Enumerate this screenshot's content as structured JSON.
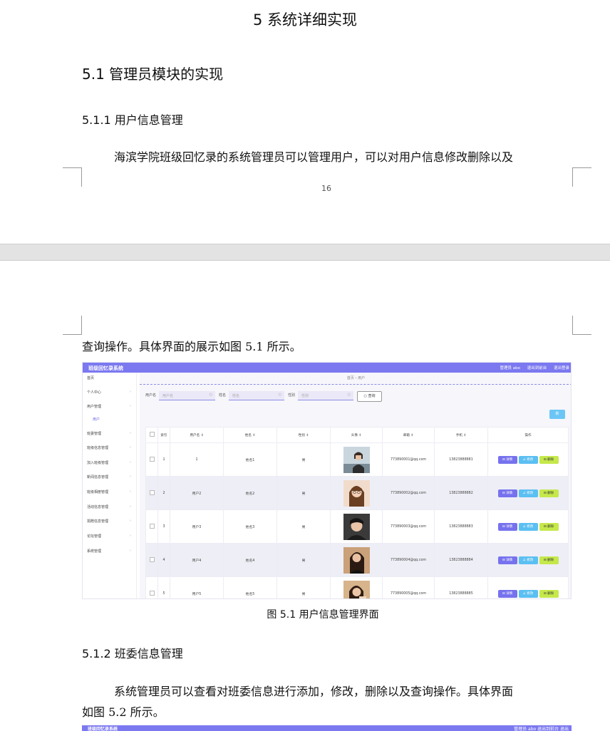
{
  "page1": {
    "chapter": "5 系统详细实现",
    "h2": "5.1  管理员模块的实现",
    "h3": "5.1.1  用户信息管理",
    "para_line1": "海滨学院班级回忆录的系统管理员可以管理用户，可以对用户信息修改删除以及",
    "page_number": "16"
  },
  "page2": {
    "para_cont": "查询操作。具体界面的展示如图 5.1 所示。",
    "caption": "图 5.1  用户信息管理界面",
    "h3": "5.1.2  班委信息管理",
    "para_line1": "系统管理员可以查看对班委信息进行添加，修改，删除以及查询操作。具体界面",
    "para_line2": "如图 5.2 所示。"
  },
  "screenshot": {
    "brand": "班级回忆录系统",
    "top_right": [
      "管理员 abo",
      "退出到前台",
      "退出登录"
    ],
    "sidebar": [
      {
        "label": "首页",
        "arrow": ""
      },
      {
        "label": "个人中心",
        "arrow": "›"
      },
      {
        "label": "用户管理",
        "arrow": "›"
      },
      {
        "label": "用户",
        "arrow": "",
        "sub": true
      },
      {
        "label": "班委管理",
        "arrow": "›"
      },
      {
        "label": "班级信息管理",
        "arrow": "›"
      },
      {
        "label": "加入班级管理",
        "arrow": "›"
      },
      {
        "label": "新闻信息管理",
        "arrow": "›"
      },
      {
        "label": "班级相册管理",
        "arrow": "›"
      },
      {
        "label": "活动信息管理",
        "arrow": "›"
      },
      {
        "label": "捐赠信息管理",
        "arrow": "›"
      },
      {
        "label": "论坛管理",
        "arrow": "›"
      },
      {
        "label": "系统管理",
        "arrow": "›"
      }
    ],
    "breadcrumb": "首页  ›  用户",
    "search": {
      "username_label": "用户名",
      "username_ph": "用户名",
      "name_label": "姓名",
      "name_ph": "姓名",
      "gender_label": "性别",
      "gender_ph": "性别",
      "query_btn": "○ 查询"
    },
    "add_btn": "新",
    "columns": [
      "",
      "索引",
      "用户名 ⇕",
      "姓名 ⇕",
      "性别 ⇕",
      "头像 ⇕",
      "邮箱 ⇕",
      "手机 ⇕",
      "操作"
    ],
    "rows": [
      {
        "idx": "1",
        "username": "1",
        "name": "姓名1",
        "gender": "男",
        "email": "773890001@qq.com",
        "phone": "13823888881"
      },
      {
        "idx": "2",
        "username": "用户2",
        "name": "姓名2",
        "gender": "男",
        "email": "773890002@qq.com",
        "phone": "13823888882"
      },
      {
        "idx": "3",
        "username": "用户3",
        "name": "姓名3",
        "gender": "男",
        "email": "773890003@qq.com",
        "phone": "13823888883"
      },
      {
        "idx": "4",
        "username": "用户4",
        "name": "姓名4",
        "gender": "男",
        "email": "773890004@qq.com",
        "phone": "13823888884"
      },
      {
        "idx": "5",
        "username": "用户5",
        "name": "姓名5",
        "gender": "男",
        "email": "773890005@qq.com",
        "phone": "13823888885"
      }
    ],
    "actions": {
      "view": "⊟ 详情",
      "edit": "∠ 修改",
      "del": "⊟ 删除"
    }
  },
  "screenshot2": {
    "brand": "班级回忆录系统",
    "top_right": "管理员 abo   退出到前台   退出"
  },
  "colors": {
    "accent": "#7b78f0",
    "edit": "#5bbff2",
    "delete": "#c5e84b"
  }
}
